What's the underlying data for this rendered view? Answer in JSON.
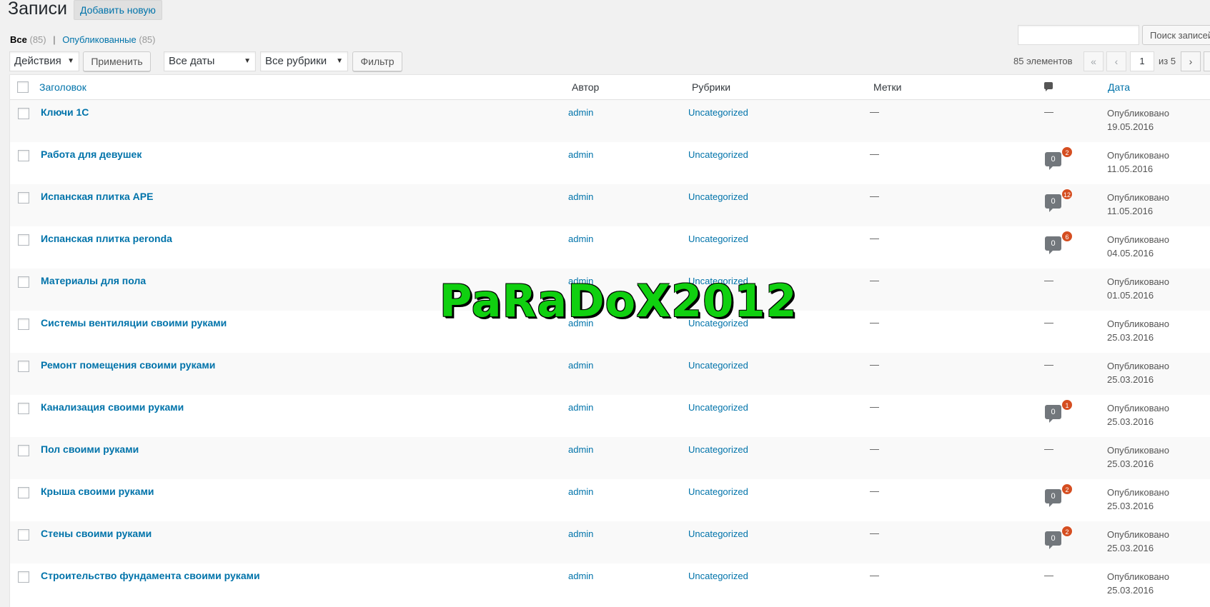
{
  "header": {
    "title": "Записи",
    "add_new": "Добавить новую"
  },
  "views": {
    "all_label": "Все",
    "all_count": "(85)",
    "separator": "|",
    "published_label": "Опубликованные",
    "published_count": "(85)"
  },
  "search": {
    "value": "",
    "button_label": "Поиск записей"
  },
  "tablenav": {
    "bulk_action": "Действия",
    "apply_label": "Применить",
    "date_filter": "Все даты",
    "category_filter": "Все рубрики",
    "filter_label": "Фильтр",
    "items_count": "85 элементов",
    "first_page": "«",
    "prev_page": "‹",
    "current_page": "1",
    "of_pages": "из 5",
    "next_page": "›"
  },
  "columns": {
    "title": "Заголовок",
    "author": "Автор",
    "categories": "Рубрики",
    "tags": "Метки",
    "date": "Дата"
  },
  "rows": [
    {
      "title": "Ключи 1С",
      "author": "admin",
      "category": "Uncategorized",
      "tags": "—",
      "comments": "—",
      "approved": null,
      "pending": null,
      "status": "Опубликовано",
      "date": "19.05.2016"
    },
    {
      "title": "Работа для девушек",
      "author": "admin",
      "category": "Uncategorized",
      "tags": "—",
      "comments": null,
      "approved": "0",
      "pending": "2",
      "status": "Опубликовано",
      "date": "11.05.2016"
    },
    {
      "title": "Испанская плитка APE",
      "author": "admin",
      "category": "Uncategorized",
      "tags": "—",
      "comments": null,
      "approved": "0",
      "pending": "12",
      "status": "Опубликовано",
      "date": "11.05.2016"
    },
    {
      "title": "Испанская плитка peronda",
      "author": "admin",
      "category": "Uncategorized",
      "tags": "—",
      "comments": null,
      "approved": "0",
      "pending": "6",
      "status": "Опубликовано",
      "date": "04.05.2016"
    },
    {
      "title": "Материалы для пола",
      "author": "admin",
      "category": "Uncategorized",
      "tags": "—",
      "comments": "—",
      "approved": null,
      "pending": null,
      "status": "Опубликовано",
      "date": "01.05.2016"
    },
    {
      "title": "Системы вентиляции своими руками",
      "author": "admin",
      "category": "Uncategorized",
      "tags": "—",
      "comments": "—",
      "approved": null,
      "pending": null,
      "status": "Опубликовано",
      "date": "25.03.2016"
    },
    {
      "title": "Ремонт помещения своими руками",
      "author": "admin",
      "category": "Uncategorized",
      "tags": "—",
      "comments": "—",
      "approved": null,
      "pending": null,
      "status": "Опубликовано",
      "date": "25.03.2016"
    },
    {
      "title": "Канализация своими руками",
      "author": "admin",
      "category": "Uncategorized",
      "tags": "—",
      "comments": null,
      "approved": "0",
      "pending": "1",
      "status": "Опубликовано",
      "date": "25.03.2016"
    },
    {
      "title": "Пол своими руками",
      "author": "admin",
      "category": "Uncategorized",
      "tags": "—",
      "comments": "—",
      "approved": null,
      "pending": null,
      "status": "Опубликовано",
      "date": "25.03.2016"
    },
    {
      "title": "Крыша своими руками",
      "author": "admin",
      "category": "Uncategorized",
      "tags": "—",
      "comments": null,
      "approved": "0",
      "pending": "2",
      "status": "Опубликовано",
      "date": "25.03.2016"
    },
    {
      "title": "Стены своими руками",
      "author": "admin",
      "category": "Uncategorized",
      "tags": "—",
      "comments": null,
      "approved": "0",
      "pending": "2",
      "status": "Опубликовано",
      "date": "25.03.2016"
    },
    {
      "title": "Строительство фундамента своими руками",
      "author": "admin",
      "category": "Uncategorized",
      "tags": "—",
      "comments": "—",
      "approved": null,
      "pending": null,
      "status": "Опубликовано",
      "date": "25.03.2016"
    }
  ],
  "watermark": "PaRaDoX2012",
  "colors": {
    "link": "#0073aa",
    "pending_badge": "#d54e21",
    "comment_bubble": "#72777c",
    "watermark": "#10d010"
  }
}
